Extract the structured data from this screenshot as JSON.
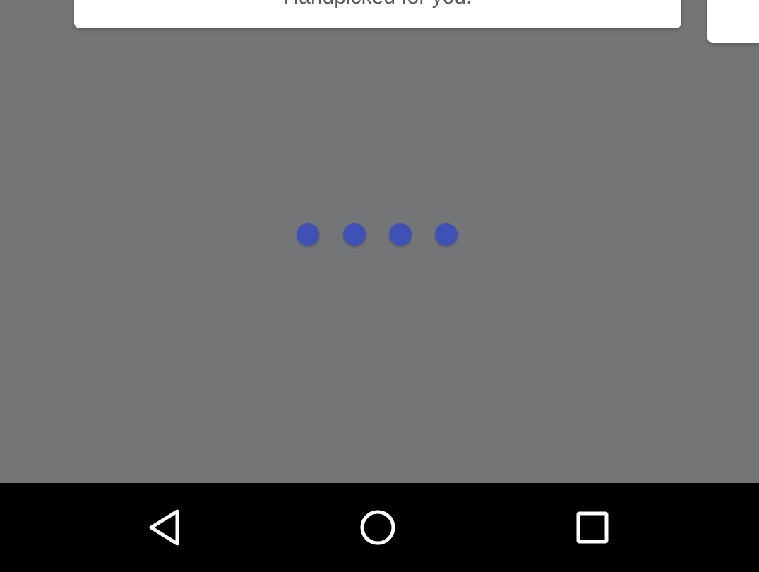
{
  "card": {
    "title": "Handpicked for you."
  },
  "loading_indicator": {
    "dot_count": 4,
    "color": "#3f51b5"
  },
  "colors": {
    "scrim": "#747577",
    "card_background": "#ffffff",
    "navigation_bar": "#000000",
    "navigation_icons": "#ffffff"
  },
  "navigation_bar": {
    "buttons": [
      {
        "icon": "back-triangle-icon"
      },
      {
        "icon": "home-circle-icon"
      },
      {
        "icon": "recent-apps-square-icon"
      }
    ]
  }
}
